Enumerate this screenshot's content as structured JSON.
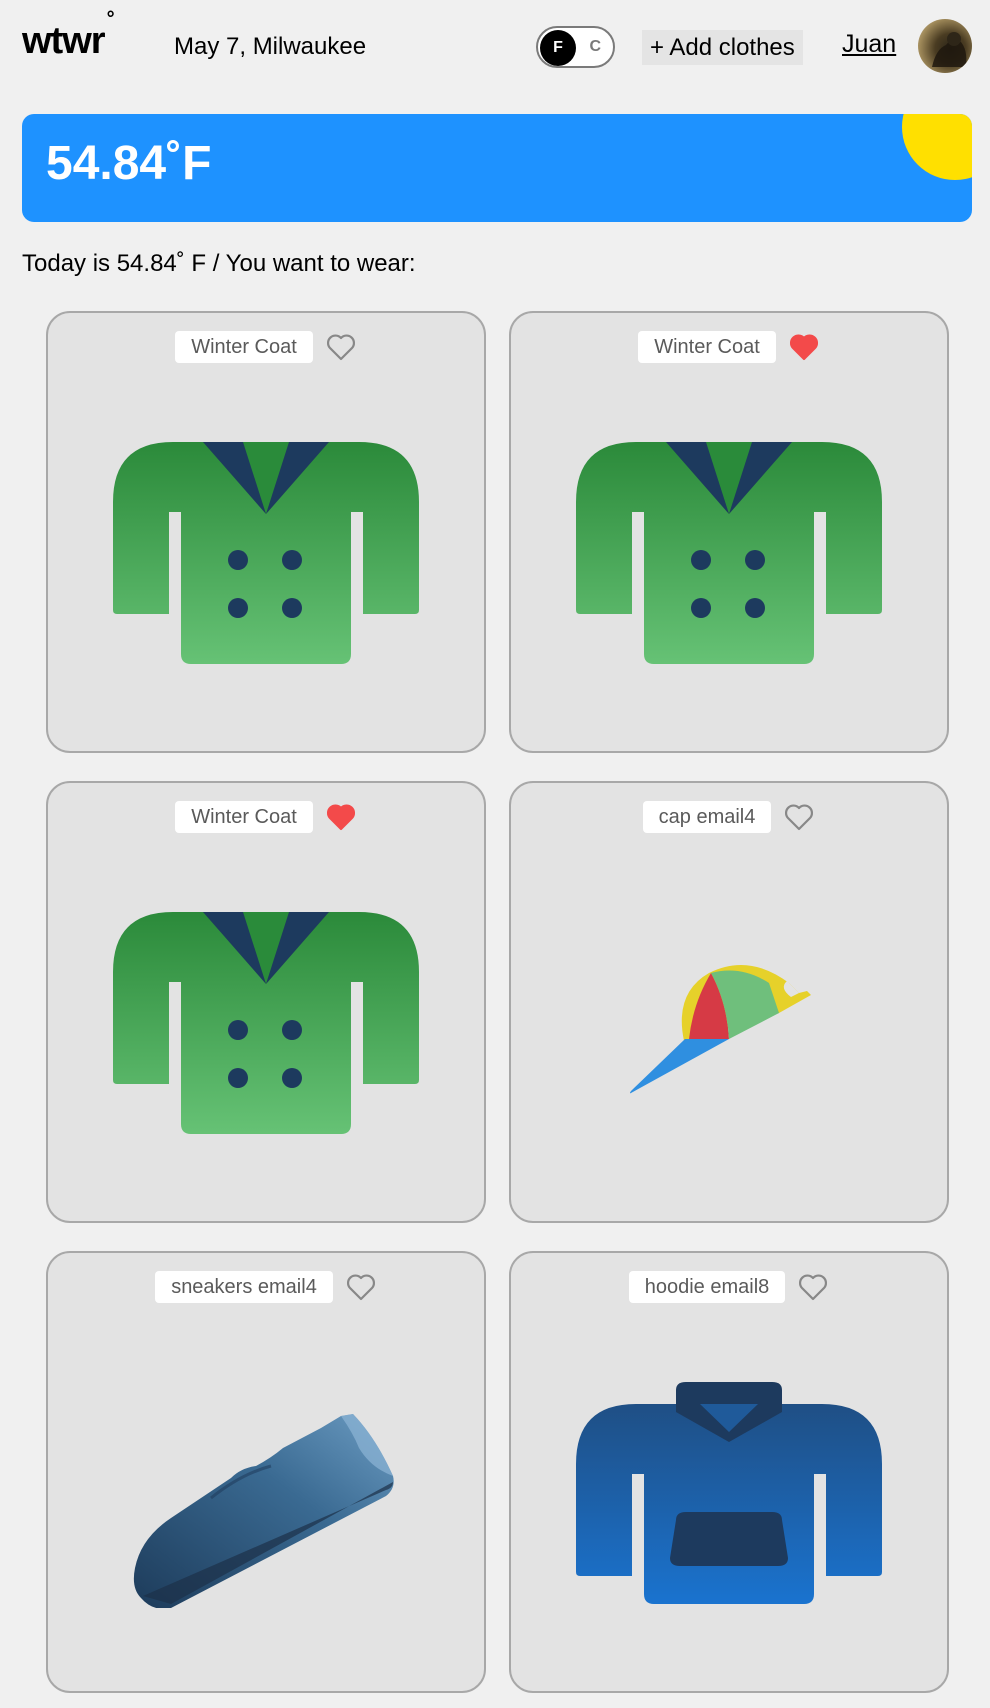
{
  "header": {
    "logo": "wtwr",
    "logo_mark": "°",
    "date_location": "May 7, Milwaukee",
    "unit_toggle": {
      "selected": "F",
      "other": "C"
    },
    "add_clothes_label": "+ Add clothes",
    "user_name": "Juan"
  },
  "weather": {
    "temperature": "54.84˚F",
    "condition_icon": "sun-icon",
    "background_color": "#1e92ff",
    "sun_color": "#ffe000"
  },
  "today_text": "Today is 54.84˚ F / You want to wear:",
  "cards": [
    {
      "name": "Winter Coat",
      "liked": false,
      "image": "coat-icon"
    },
    {
      "name": "Winter Coat",
      "liked": true,
      "image": "coat-icon"
    },
    {
      "name": "Winter Coat",
      "liked": true,
      "image": "coat-icon"
    },
    {
      "name": "cap email4",
      "liked": false,
      "image": "cap-icon"
    },
    {
      "name": "sneakers email4",
      "liked": false,
      "image": "sneaker-icon"
    },
    {
      "name": "hoodie email8",
      "liked": false,
      "image": "hoodie-icon"
    }
  ],
  "colors": {
    "liked_heart": "#f34a4a",
    "unliked_heart": "#888888"
  }
}
